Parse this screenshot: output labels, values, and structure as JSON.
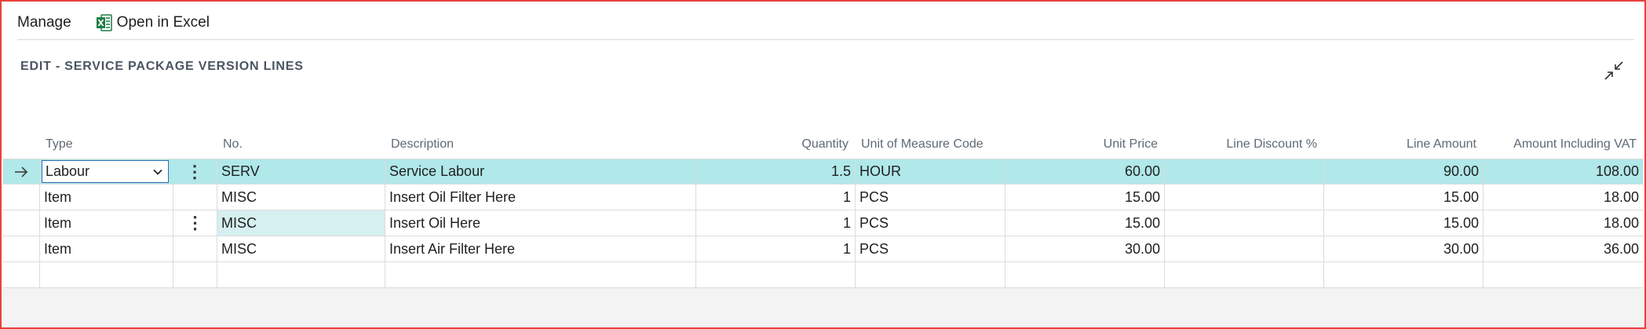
{
  "toolbar": {
    "manage": "Manage",
    "open_in_excel": "Open in Excel"
  },
  "page_title": "EDIT - SERVICE PACKAGE VERSION LINES",
  "columns": {
    "type": "Type",
    "no": "No.",
    "description": "Description",
    "quantity": "Quantity",
    "uom": "Unit of Measure Code",
    "unit_price": "Unit Price",
    "line_discount": "Line Discount %",
    "line_amount": "Line Amount",
    "amount_incl_vat": "Amount Including VAT"
  },
  "rows": [
    {
      "type": "Labour",
      "no": "SERV",
      "description": "Service Labour",
      "quantity": "1.5",
      "uom": "HOUR",
      "unit_price": "60.00",
      "line_discount": "",
      "line_amount": "90.00",
      "amount_incl_vat": "108.00"
    },
    {
      "type": "Item",
      "no": "MISC",
      "description": "Insert Oil Filter Here",
      "quantity": "1",
      "uom": "PCS",
      "unit_price": "15.00",
      "line_discount": "",
      "line_amount": "15.00",
      "amount_incl_vat": "18.00"
    },
    {
      "type": "Item",
      "no": "MISC",
      "description": "Insert Oil Here",
      "quantity": "1",
      "uom": "PCS",
      "unit_price": "15.00",
      "line_discount": "",
      "line_amount": "15.00",
      "amount_incl_vat": "18.00"
    },
    {
      "type": "Item",
      "no": "MISC",
      "description": "Insert Air Filter Here",
      "quantity": "1",
      "uom": "PCS",
      "unit_price": "30.00",
      "line_discount": "",
      "line_amount": "30.00",
      "amount_incl_vat": "36.00"
    }
  ],
  "icons": {
    "row_indicator": "arrow-right-icon",
    "row_menu": "more-vertical-icon",
    "type_dropdown": "chevron-down-icon",
    "excel": "excel-icon",
    "collapse": "collapse-icon"
  },
  "colors": {
    "selected_row": "#b1e8e9",
    "focused_cell": "#d6eff0",
    "frame_border": "#e8413c",
    "excel_green": "#1d7b45"
  }
}
